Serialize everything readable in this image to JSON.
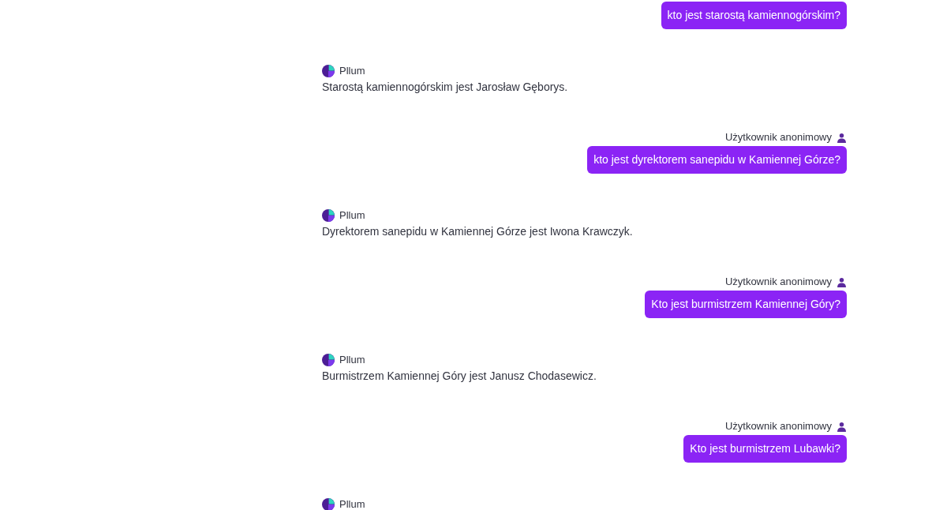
{
  "messages": [
    {
      "kind": "user",
      "text": "kto jest starostą kamiennogórskim?"
    },
    {
      "kind": "bot",
      "author": "Pllum",
      "text": "Starostą kamiennogórskim jest Jarosław Gęborys."
    },
    {
      "kind": "user",
      "author": "Użytkownik anonimowy",
      "text": "kto jest dyrektorem sanepidu w Kamiennej Górze?"
    },
    {
      "kind": "bot",
      "author": "Pllum",
      "text": "Dyrektorem sanepidu w Kamiennej Górze jest Iwona Krawczyk."
    },
    {
      "kind": "user",
      "author": "Użytkownik anonimowy",
      "text": "Kto jest burmistrzem Kamiennej Góry?"
    },
    {
      "kind": "bot",
      "author": "Pllum",
      "text": "Burmistrzem Kamiennej Góry jest Janusz Chodasewicz."
    },
    {
      "kind": "user",
      "author": "Użytkownik anonimowy",
      "text": "Kto jest burmistrzem Lubawki?"
    },
    {
      "kind": "bot",
      "author": "Pllum"
    }
  ]
}
